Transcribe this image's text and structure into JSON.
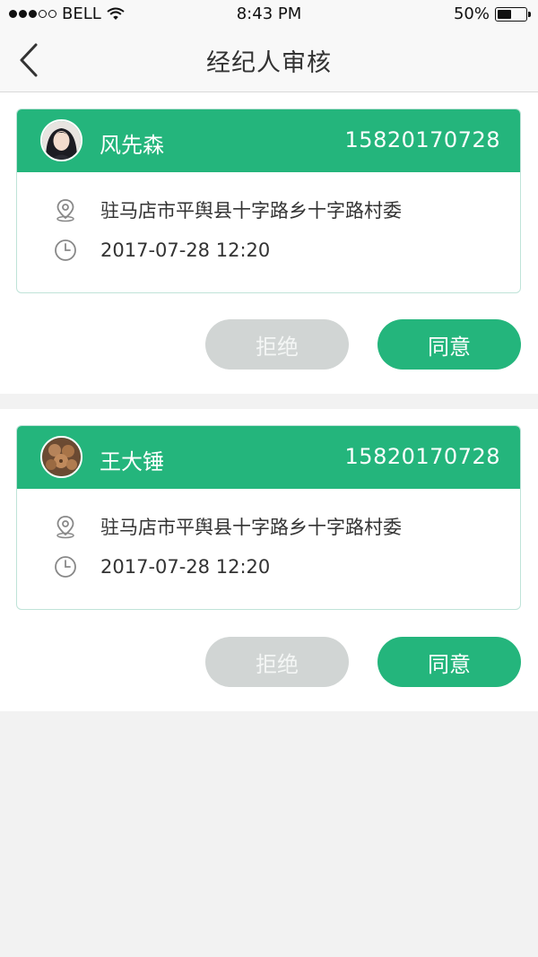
{
  "status": {
    "carrier": "BELL",
    "time": "8:43 PM",
    "battery": "50%",
    "battery_level": 0.5
  },
  "nav": {
    "title": "经纪人审核"
  },
  "applications": [
    {
      "name": "风先森",
      "phone": "15820170728",
      "address": "驻马店市平舆县十字路乡十字路村委",
      "time": "2017-07-28 12:20",
      "reject_label": "拒绝",
      "agree_label": "同意"
    },
    {
      "name": "王大锤",
      "phone": "15820170728",
      "address": "驻马店市平舆县十字路乡十字路村委",
      "time": "2017-07-28 12:20",
      "reject_label": "拒绝",
      "agree_label": "同意"
    }
  ],
  "colors": {
    "accent": "#24b57c",
    "reject": "#d1d5d4",
    "background": "#f2f2f2"
  }
}
